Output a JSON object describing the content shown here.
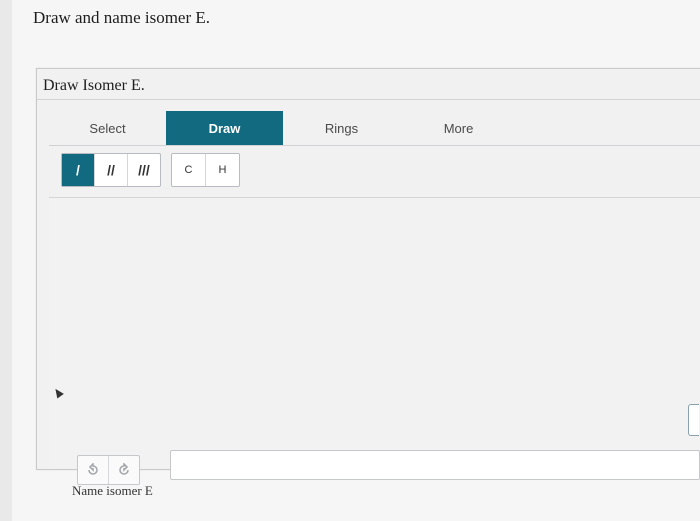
{
  "question": {
    "title": "Draw and name isomer E."
  },
  "sketch": {
    "title": "Draw Isomer E.",
    "tabs": [
      {
        "label": "Select",
        "active": false
      },
      {
        "label": "Draw",
        "active": true
      },
      {
        "label": "Rings",
        "active": false
      },
      {
        "label": "More",
        "active": false
      }
    ],
    "bond_tools": [
      {
        "label": "/",
        "icon": "single-bond-icon",
        "selected": true
      },
      {
        "label": "//",
        "icon": "double-bond-icon",
        "selected": false
      },
      {
        "label": "///",
        "icon": "triple-bond-icon",
        "selected": false
      }
    ],
    "atom_tools": [
      {
        "label": "C"
      },
      {
        "label": "H"
      }
    ],
    "history": [
      "undo-icon",
      "redo-icon"
    ]
  },
  "name_field": {
    "label": "Name isomer E",
    "value": ""
  },
  "colors": {
    "accent": "#116a80",
    "background": "#e9e9ea"
  }
}
